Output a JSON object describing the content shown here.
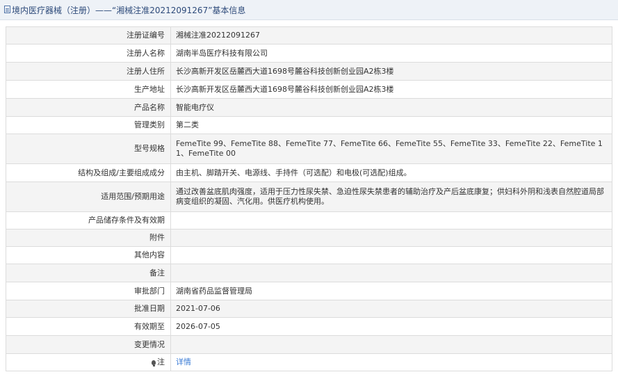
{
  "header": {
    "title": "境内医疗器械（注册）——“湘械注准20212091267”基本信息",
    "icon": "document-icon"
  },
  "rows": [
    {
      "label": "注册证编号",
      "value": "湘械注准20212091267"
    },
    {
      "label": "注册人名称",
      "value": "湖南半岛医疗科技有限公司"
    },
    {
      "label": "注册人住所",
      "value": "长沙高新开发区岳麓西大道1698号麓谷科技创新创业园A2栋3楼"
    },
    {
      "label": "生产地址",
      "value": "长沙高新开发区岳麓西大道1698号麓谷科技创新创业园A2栋3楼"
    },
    {
      "label": "产品名称",
      "value": "智能电疗仪"
    },
    {
      "label": "管理类别",
      "value": "第二类"
    },
    {
      "label": "型号规格",
      "value": "FemeTite 99、FemeTite 88、FemeTite 77、FemeTite 66、FemeTite 55、FemeTite 33、FemeTite 22、FemeTite 11、FemeTite 00"
    },
    {
      "label": "结构及组成/主要组成成分",
      "value": "由主机、脚踏开关、电源线、手持件（可选配）和电极(可选配)组成。"
    },
    {
      "label": "适用范围/预期用途",
      "value": "通过改善盆底肌肉强度，适用于压力性尿失禁、急迫性尿失禁患者的辅助治疗及产后盆底康复；供妇科外阴和浅表自然腔道局部病变组织的凝固、汽化用。供医疗机构使用。"
    },
    {
      "label": "产品储存条件及有效期",
      "value": ""
    },
    {
      "label": "附件",
      "value": ""
    },
    {
      "label": "其他内容",
      "value": ""
    },
    {
      "label": "备注",
      "value": ""
    },
    {
      "label": "审批部门",
      "value": "湖南省药品监督管理局"
    },
    {
      "label": "批准日期",
      "value": "2021-07-06"
    },
    {
      "label": "有效期至",
      "value": "2026-07-05"
    },
    {
      "label": "变更情况",
      "value": ""
    },
    {
      "label": "注",
      "value": "详情"
    }
  ],
  "colors": {
    "header_bg": "#eef2f7",
    "header_text": "#2d4a7a",
    "link": "#3a7bd5",
    "row_alt": "#f4f4f4",
    "border": "#dcdcdc"
  }
}
